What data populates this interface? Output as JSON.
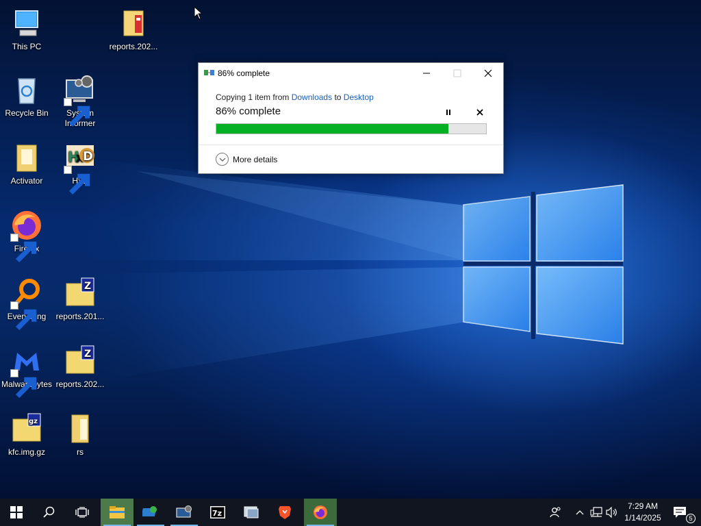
{
  "desktop": {
    "icons": [
      {
        "label": "This PC",
        "icon": "computer-icon"
      },
      {
        "label": "reports.202...",
        "icon": "archive-folder-icon"
      },
      {
        "label": "Recycle Bin",
        "icon": "recycle-bin-icon"
      },
      {
        "label": "System Informer",
        "icon": "system-informer-icon"
      },
      {
        "label": "Activator",
        "icon": "folder-icon"
      },
      {
        "label": "HxD",
        "icon": "hxd-icon"
      },
      {
        "label": "Firefox",
        "icon": "firefox-icon"
      },
      {
        "label": "Everything",
        "icon": "everything-search-icon"
      },
      {
        "label": "reports.201...",
        "icon": "zip-folder-icon"
      },
      {
        "label": "Malwarebytes",
        "icon": "malwarebytes-icon"
      },
      {
        "label": "reports.202...",
        "icon": "zip-folder-icon"
      },
      {
        "label": "kfc.img.gz",
        "icon": "gz-archive-icon"
      },
      {
        "label": "rs",
        "icon": "folder-icon"
      }
    ]
  },
  "copy_dialog": {
    "title": "86% complete",
    "line_prefix": "Copying 1 item from",
    "source": "Downloads",
    "line_mid": "to",
    "destination": "Desktop",
    "status": "86% complete",
    "progress": 0.86,
    "more_details": "More details",
    "progress_color": "#06b025"
  },
  "taskbar": {
    "items": [
      "start-icon",
      "search-icon",
      "task-view-icon",
      "file-explorer-icon",
      "remote-desktop-icon",
      "system-informer-icon",
      "7zip-icon",
      "media-icon",
      "brave-icon",
      "firefox-icon"
    ],
    "clock": {
      "time": "7:29 AM",
      "date": "1/14/2025"
    },
    "notifications_count": "5",
    "accent": "#76b9ed"
  }
}
